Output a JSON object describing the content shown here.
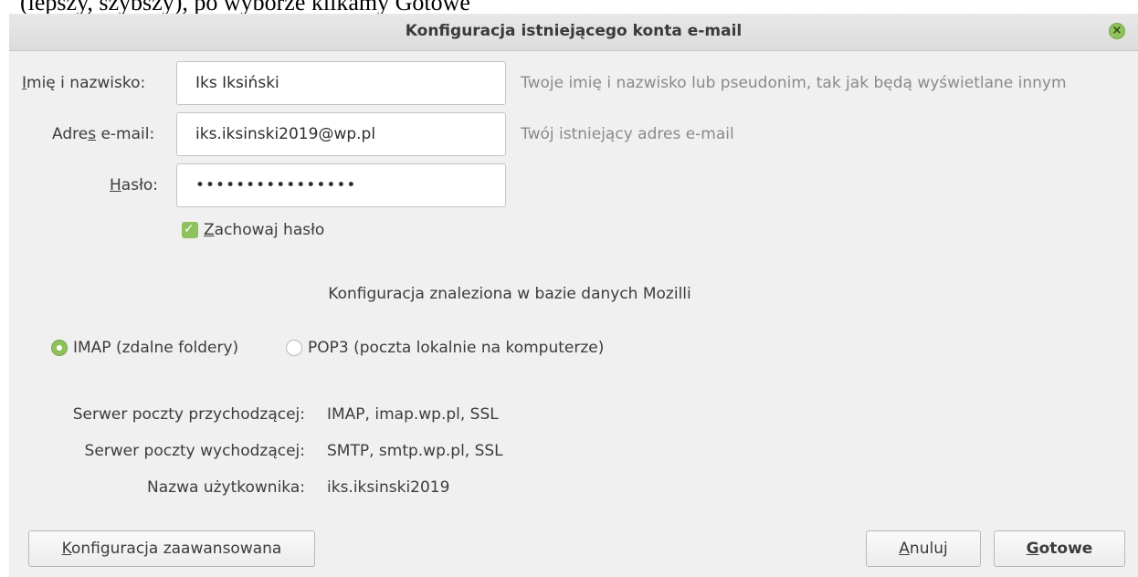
{
  "document": {
    "fragment_text": "(lepszy, szybszy), po wyborze klikamy Gotowe"
  },
  "dialog": {
    "title": "Konfiguracja istniejącego konta e-mail",
    "close_icon": "close-icon",
    "accent_color": "#8fc15c"
  },
  "form": {
    "name": {
      "label_underlined": "I",
      "label_rest": "mię i nazwisko:",
      "value": "Iks Iksiński",
      "hint": "Twoje imię i nazwisko lub pseudonim, tak jak będą wyświetlane innym"
    },
    "email": {
      "label_before": "Adre",
      "label_underlined": "s",
      "label_after": " e-mail:",
      "value": "iks.iksinski2019@wp.pl",
      "hint": "Twój istniejący adres e-mail"
    },
    "password": {
      "label_underlined": "H",
      "label_rest": "asło:",
      "value": "••••••••••••••••"
    },
    "remember": {
      "underlined": "Z",
      "rest": "achowaj hasło",
      "checked": true
    }
  },
  "config": {
    "found_text": "Konfiguracja znaleziona w bazie danych Mozilli",
    "protocols": [
      {
        "label": "IMAP (zdalne foldery)",
        "selected": true
      },
      {
        "label": "POP3 (poczta lokalnie na komputerze)",
        "selected": false
      }
    ]
  },
  "server_info": {
    "incoming_label": "Serwer poczty przychodzącej:",
    "incoming_value": "IMAP, imap.wp.pl, SSL",
    "outgoing_label": "Serwer poczty wychodzącej:",
    "outgoing_value": "SMTP, smtp.wp.pl, SSL",
    "username_label": "Nazwa użytkownika:",
    "username_value": "iks.iksinski2019"
  },
  "buttons": {
    "advanced_underlined": "K",
    "advanced_rest": "onfiguracja zaawansowana",
    "cancel_underlined": "A",
    "cancel_rest": "nuluj",
    "done_underlined": "G",
    "done_rest": "otowe"
  }
}
